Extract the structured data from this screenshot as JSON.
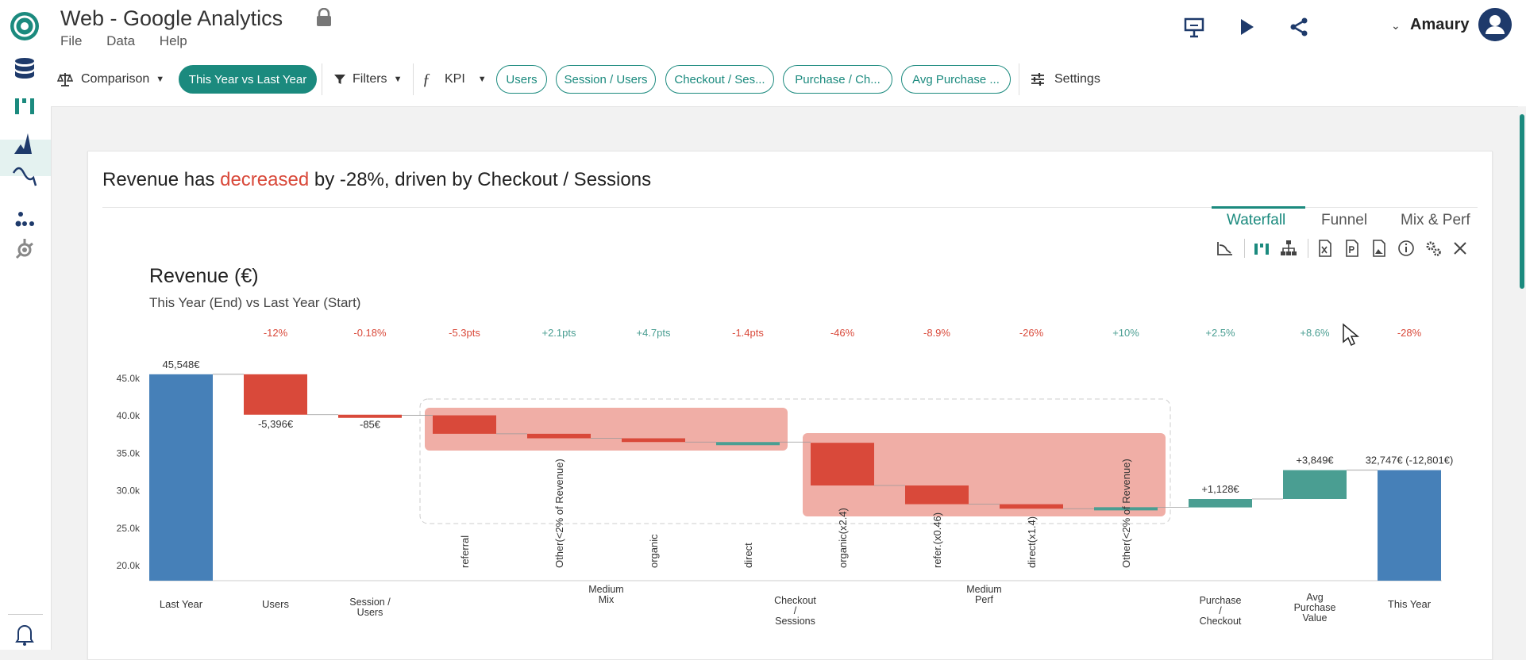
{
  "app": {
    "title": "Web - Google Analytics",
    "menu": [
      "File",
      "Data",
      "Help"
    ],
    "user": "Amaury"
  },
  "toolbar": {
    "comparison_label": "Comparison",
    "comparison_value": "This Year vs Last Year",
    "filters_label": "Filters",
    "kpi_label": "KPI",
    "kpis": [
      "Users",
      "Session / Users",
      "Checkout / Ses...",
      "Purchase / Ch...",
      "Avg Purchase ..."
    ],
    "settings_label": "Settings"
  },
  "headline": {
    "prefix": "Revenue has ",
    "direction": "decreased",
    "suffix": " by -28%, driven by Checkout / Sessions"
  },
  "view_tabs": [
    "Waterfall",
    "Funnel",
    "Mix & Perf"
  ],
  "colors": {
    "accent": "#1b8a7e",
    "negative": "#d9493a",
    "positive": "#4a9e92",
    "total": "#4680b8",
    "group_highlight": "#eea59c"
  },
  "icons": [
    "trend-icon",
    "waterfall-icon",
    "hierarchy-icon",
    "excel-icon",
    "pdf-icon",
    "image-icon",
    "info-icon",
    "settings-gear-icon",
    "close-icon"
  ],
  "chart_data": {
    "type": "waterfall",
    "title": "Revenue (€)",
    "subtitle": "This Year (End) vs Last Year (Start)",
    "ylim": [
      20000,
      45000
    ],
    "yticks": [
      20000,
      25000,
      30000,
      35000,
      40000,
      45000
    ],
    "ytick_labels": [
      "20.0k",
      "25.0k",
      "30.0k",
      "35.0k",
      "40.0k",
      "45.0k"
    ],
    "bars": [
      {
        "label": "Last Year",
        "kind": "total",
        "start": 0,
        "end": 45548,
        "value_label": "45,548€",
        "pct": ""
      },
      {
        "label": "Users",
        "kind": "neg",
        "start": 45548,
        "end": 40152,
        "value_label": "-5,396€",
        "pct": "-12%"
      },
      {
        "label": "Session / Users",
        "kind": "neg",
        "start": 40152,
        "end": 40067,
        "value_label": "-85€",
        "pct": "-0.18%"
      },
      {
        "label": "referral",
        "kind": "neg",
        "start": 40067,
        "end": 37600,
        "value_label": "",
        "pct": "-5.3pts"
      },
      {
        "label": "Other(<2% of Revenue)",
        "kind": "neg",
        "start": 37600,
        "end": 37000,
        "value_label": "",
        "pct": "+2.1pts"
      },
      {
        "label": "organic",
        "kind": "neg",
        "start": 37000,
        "end": 36500,
        "value_label": "",
        "pct": "+4.7pts"
      },
      {
        "label": "direct",
        "kind": "pos",
        "start": 36300,
        "end": 36500,
        "value_label": "",
        "pct": "-1.4pts"
      },
      {
        "label": "organic(x2.4)",
        "kind": "neg",
        "start": 36400,
        "end": 30700,
        "value_label": "",
        "pct": "-46%"
      },
      {
        "label": "refer.(x0.46)",
        "kind": "neg",
        "start": 30700,
        "end": 28200,
        "value_label": "",
        "pct": "-8.9%"
      },
      {
        "label": "direct(x1.4)",
        "kind": "neg",
        "start": 28200,
        "end": 27600,
        "value_label": "",
        "pct": "-26%"
      },
      {
        "label": "Other(<2% of Revenue)",
        "kind": "pos",
        "start": 27600,
        "end": 27800,
        "value_label": "",
        "pct": "+10%"
      },
      {
        "label": "Purchase / Checkout",
        "kind": "pos",
        "start": 27770,
        "end": 28898,
        "value_label": "+1,128€",
        "pct": "+2.5%"
      },
      {
        "label": "Avg Purchase Value",
        "kind": "pos",
        "start": 28898,
        "end": 32747,
        "value_label": "+3,849€",
        "pct": "+8.6%"
      },
      {
        "label": "This Year",
        "kind": "total",
        "start": 0,
        "end": 32747,
        "value_label": "32,747€ (-12,801€)",
        "pct": "-28%"
      }
    ],
    "groups": [
      {
        "label": "Medium Mix",
        "from": 3,
        "to": 6
      },
      {
        "label": "Medium Perf",
        "from": 7,
        "to": 10
      },
      {
        "label": "Checkout / Sessions",
        "from": 3,
        "to": 10
      }
    ]
  }
}
